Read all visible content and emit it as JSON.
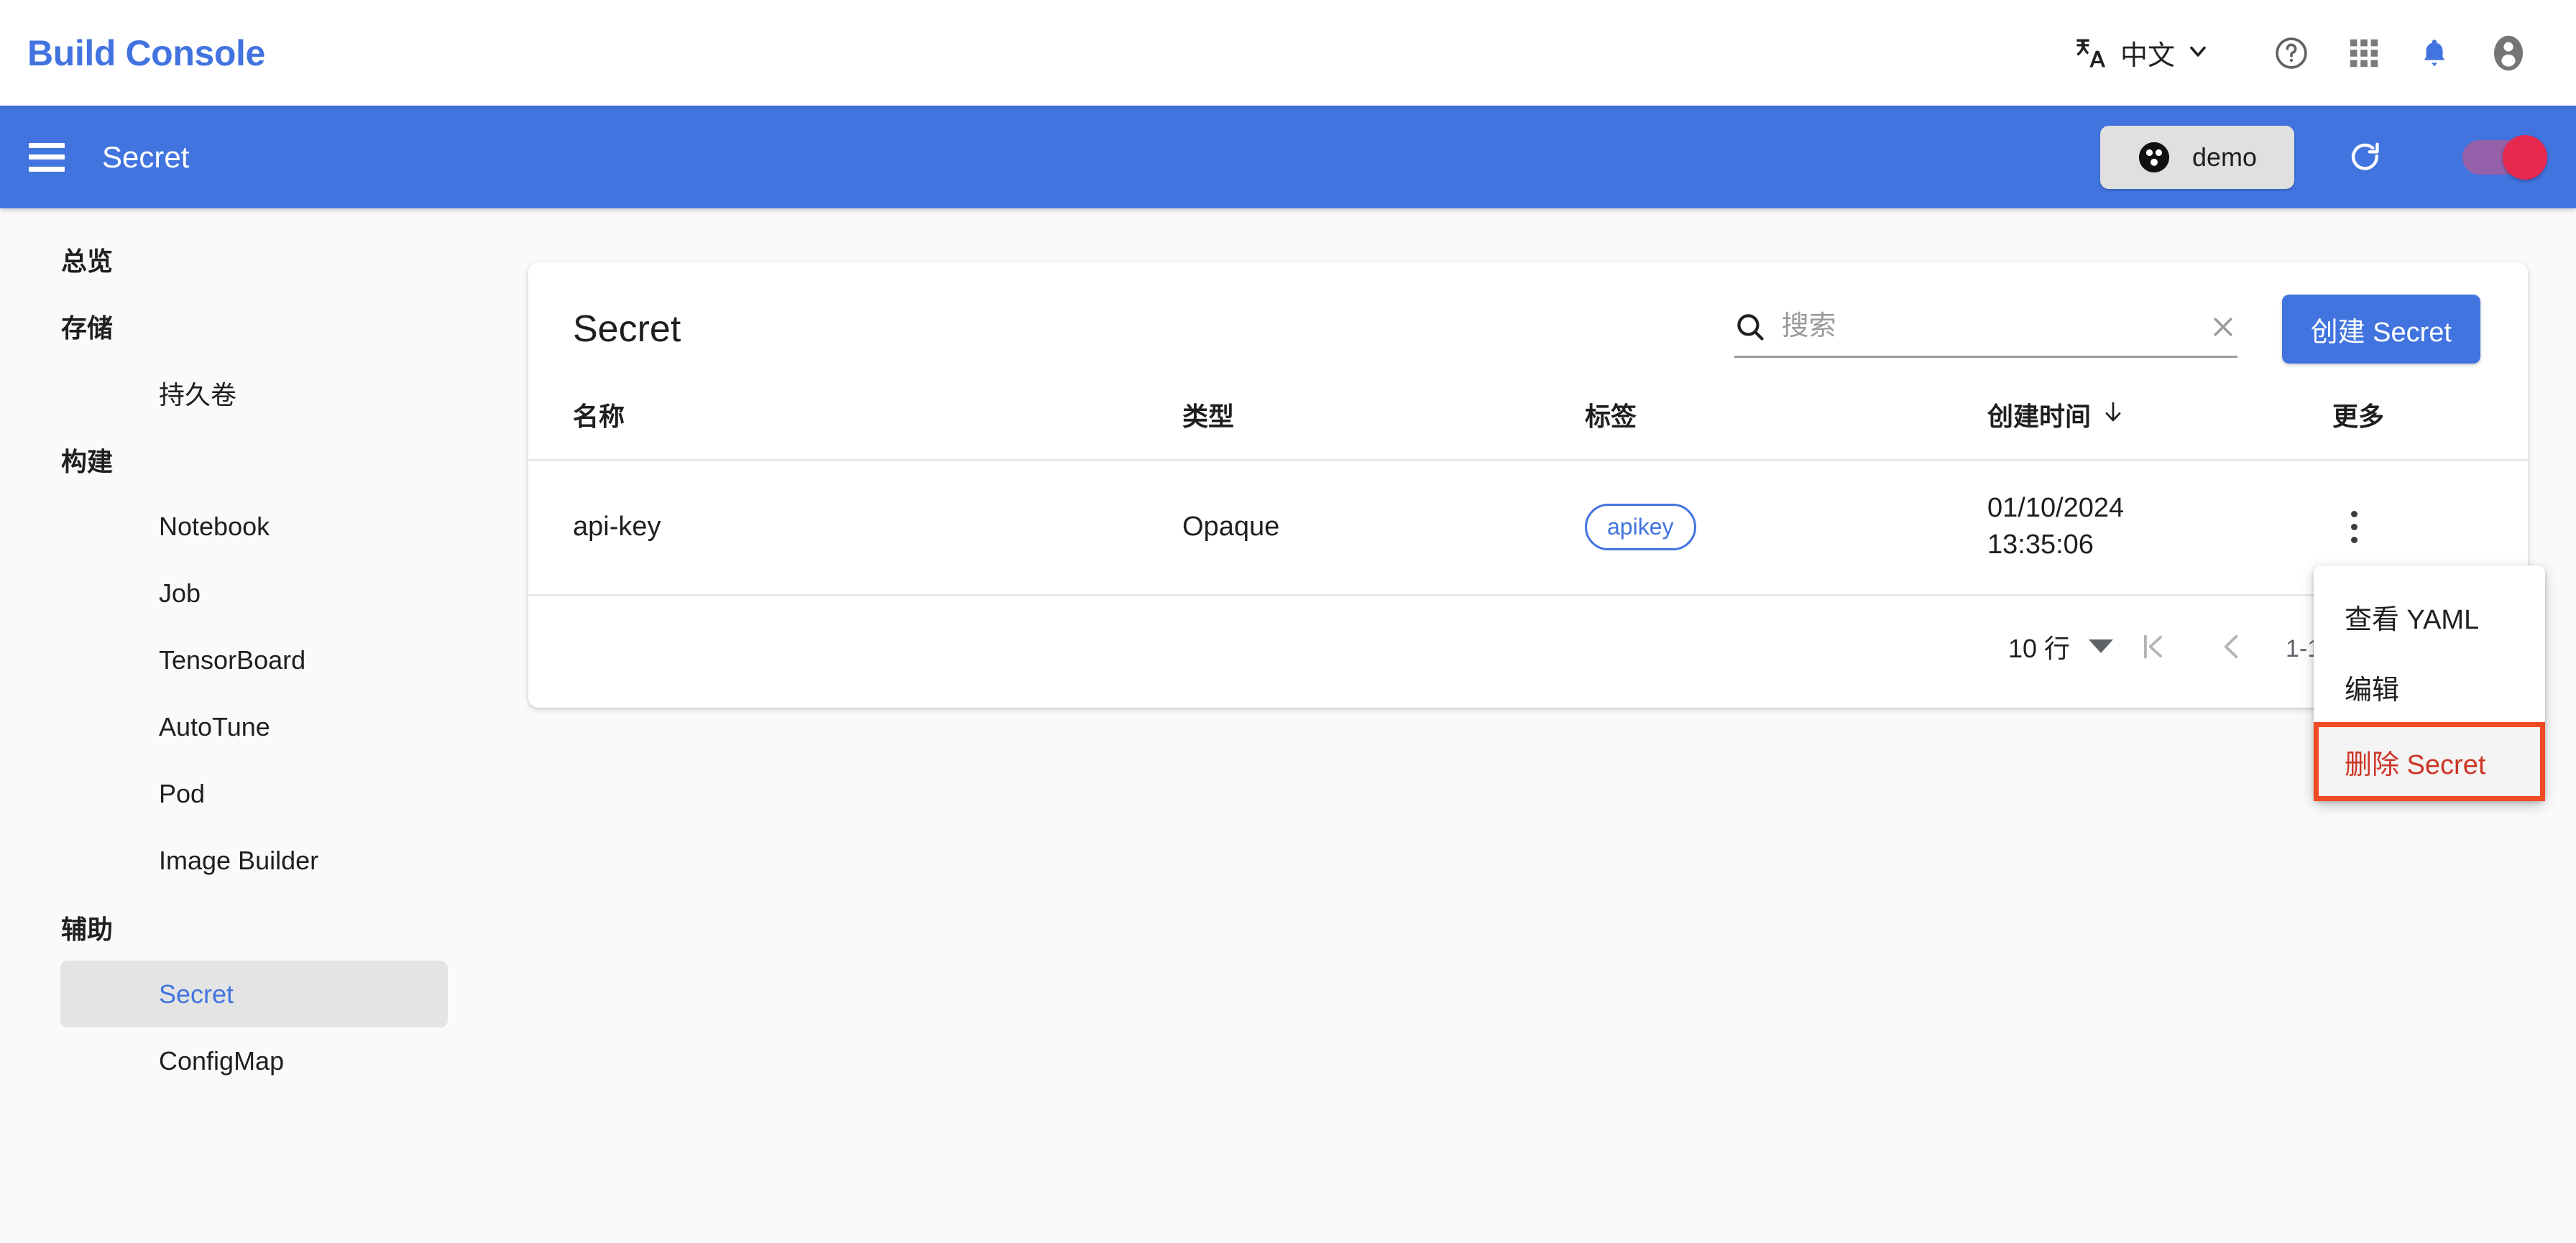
{
  "brand": {
    "title": "Build Console"
  },
  "header": {
    "language_label": "中文",
    "icons": {
      "translate": "translate-icon",
      "chevron": "chevron-down-icon",
      "help": "help-circle-icon",
      "apps": "apps-grid-icon",
      "notifications": "bell-icon",
      "account": "account-circle-icon"
    }
  },
  "toolbar": {
    "menu_icon": "hamburger-menu-icon",
    "title": "Secret",
    "namespace_chip": {
      "label": "demo",
      "icon": "namespace-icon"
    },
    "refresh_icon": "refresh-icon",
    "toggle": {
      "on": true,
      "track_color": "#9b5fa8",
      "knob_color": "#e8284f"
    }
  },
  "sidebar": {
    "items": [
      {
        "label": "总览",
        "type": "section",
        "active": false
      },
      {
        "label": "存储",
        "type": "section",
        "active": false
      },
      {
        "label": "持久卷",
        "type": "item",
        "active": false
      },
      {
        "label": "构建",
        "type": "section",
        "active": false
      },
      {
        "label": "Notebook",
        "type": "item",
        "active": false
      },
      {
        "label": "Job",
        "type": "item",
        "active": false
      },
      {
        "label": "TensorBoard",
        "type": "item",
        "active": false
      },
      {
        "label": "AutoTune",
        "type": "item",
        "active": false
      },
      {
        "label": "Pod",
        "type": "item",
        "active": false
      },
      {
        "label": "Image Builder",
        "type": "item",
        "active": false
      },
      {
        "label": "辅助",
        "type": "section",
        "active": false
      },
      {
        "label": "Secret",
        "type": "item",
        "active": true
      },
      {
        "label": "ConfigMap",
        "type": "item",
        "active": false
      }
    ]
  },
  "card": {
    "title": "Secret",
    "search": {
      "value": "",
      "placeholder": "搜索",
      "search_icon": "search-icon",
      "clear_icon": "close-icon"
    },
    "create_button": "创建 Secret",
    "table": {
      "columns": [
        {
          "key": "name",
          "label": "名称"
        },
        {
          "key": "type",
          "label": "类型"
        },
        {
          "key": "label",
          "label": "标签"
        },
        {
          "key": "time",
          "label": "创建时间",
          "sort": "desc",
          "sort_icon": "arrow-down-icon"
        },
        {
          "key": "more",
          "label": "更多"
        }
      ],
      "rows": [
        {
          "name": "api-key",
          "type": "Opaque",
          "label": "apikey",
          "time_date": "01/10/2024",
          "time_clock": "13:35:06",
          "more_icon": "kebab-menu-icon"
        }
      ]
    },
    "pagination": {
      "rows_per_page": "10 行",
      "range": "1-1 总计 1",
      "first_icon": "first-page-icon",
      "prev_icon": "previous-page-icon",
      "next_icon": "next-page-icon"
    }
  },
  "context_menu": {
    "items": [
      {
        "label": "查看 YAML",
        "danger": false,
        "highlighted": false
      },
      {
        "label": "编辑",
        "danger": false,
        "highlighted": false
      },
      {
        "label": "删除 Secret",
        "danger": true,
        "highlighted": true
      }
    ],
    "highlight_color": "#f04a23"
  },
  "colors": {
    "brand_blue": "#4274e0",
    "toolbar_blue": "#4274e0",
    "page_bg": "#fafafa",
    "card_bg": "#ffffff",
    "danger_red": "#cc3526"
  }
}
